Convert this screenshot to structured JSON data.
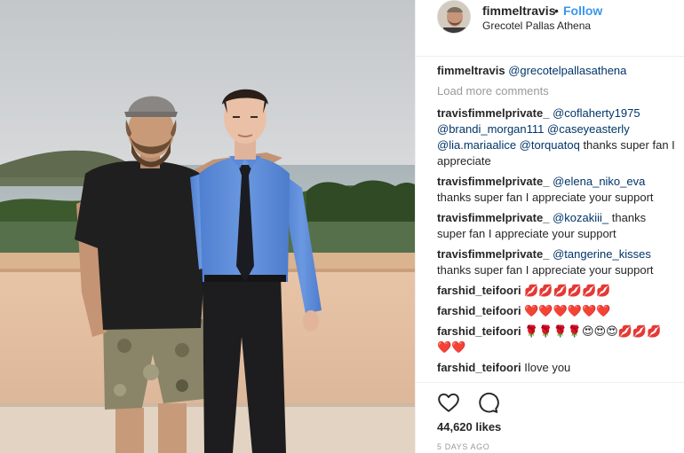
{
  "post": {
    "author": "fimmeltravis",
    "follow_label": "Follow",
    "separator": "•",
    "location": "Grecotel Pallas Athena"
  },
  "caption": {
    "user": "fimmeltravis",
    "text": "@grecotelpallasathena"
  },
  "load_more_label": "Load more comments",
  "comments": [
    {
      "user": "travisfimmelprivate_",
      "mentions": "@coflaherty1975 @brandi_morgan111 @caseyeasterly @lia.mariaalice @torquatoq",
      "text": "thanks super fan I appreciate"
    },
    {
      "user": "travisfimmelprivate_",
      "mentions": "@elena_niko_eva",
      "text": "thanks super fan I appreciate your support"
    },
    {
      "user": "travisfimmelprivate_",
      "mentions": "@kozakiii_",
      "text": "thanks super fan I appreciate your support"
    },
    {
      "user": "travisfimmelprivate_",
      "mentions": "@tangerine_kisses",
      "text": "thanks super fan I appreciate your support"
    },
    {
      "user": "farshid_teifoori",
      "mentions": "",
      "text": "💋💋💋💋💋💋"
    },
    {
      "user": "farshid_teifoori",
      "mentions": "",
      "text": "❤️❤️❤️❤️❤️❤️"
    },
    {
      "user": "farshid_teifoori",
      "mentions": "",
      "text": "🌹🌹🌹🌹😍😍😍💋💋💋❤️❤️"
    },
    {
      "user": "farshid_teifoori",
      "mentions": "",
      "text": "Ilove you"
    }
  ],
  "actions": {
    "like_icon": "heart-outline-icon",
    "comment_icon": "speech-bubble-icon"
  },
  "likes_label": "44,620 likes",
  "timestamp": "5 DAYS AGO",
  "colors": {
    "follow": "#3897f0",
    "mention": "#003569",
    "muted": "#999999",
    "text": "#262626"
  }
}
